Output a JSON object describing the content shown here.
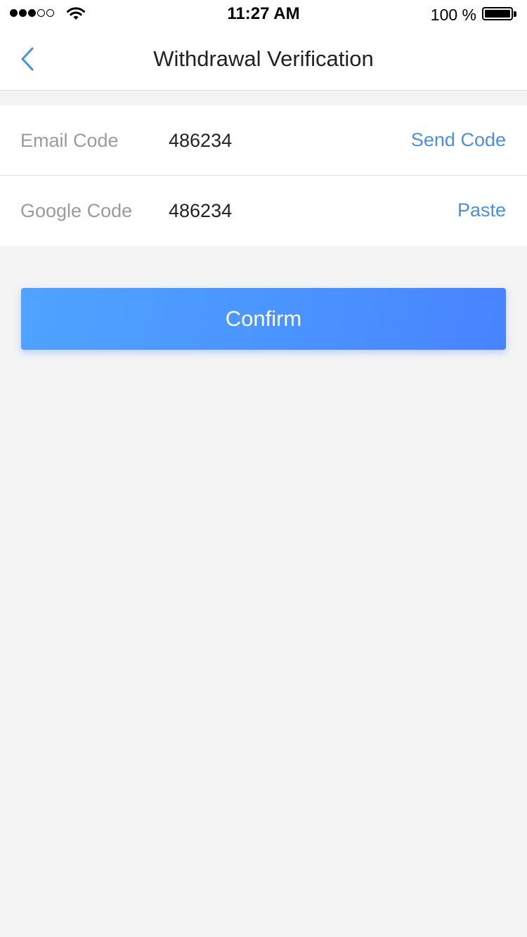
{
  "status_bar": {
    "time": "11:27 AM",
    "battery_percent": "100 %",
    "signal_bars_filled": 3,
    "signal_bars_total": 5,
    "battery_level": 1.0,
    "icons": [
      "signal-dots-icon",
      "wifi-icon",
      "battery-icon"
    ]
  },
  "nav": {
    "title": "Withdrawal Verification",
    "back_icon": "chevron-left-icon"
  },
  "form": {
    "email": {
      "label": "Email Code",
      "value": "486234",
      "action": "Send Code"
    },
    "google": {
      "label": "Google Code",
      "value": "486234",
      "action": "Paste"
    }
  },
  "confirm": {
    "label": "Confirm"
  },
  "colors": {
    "accent": "#4a90e2",
    "button_start": "#4fa3ff",
    "button_end": "#4883ff",
    "background": "#f4f4f4"
  }
}
